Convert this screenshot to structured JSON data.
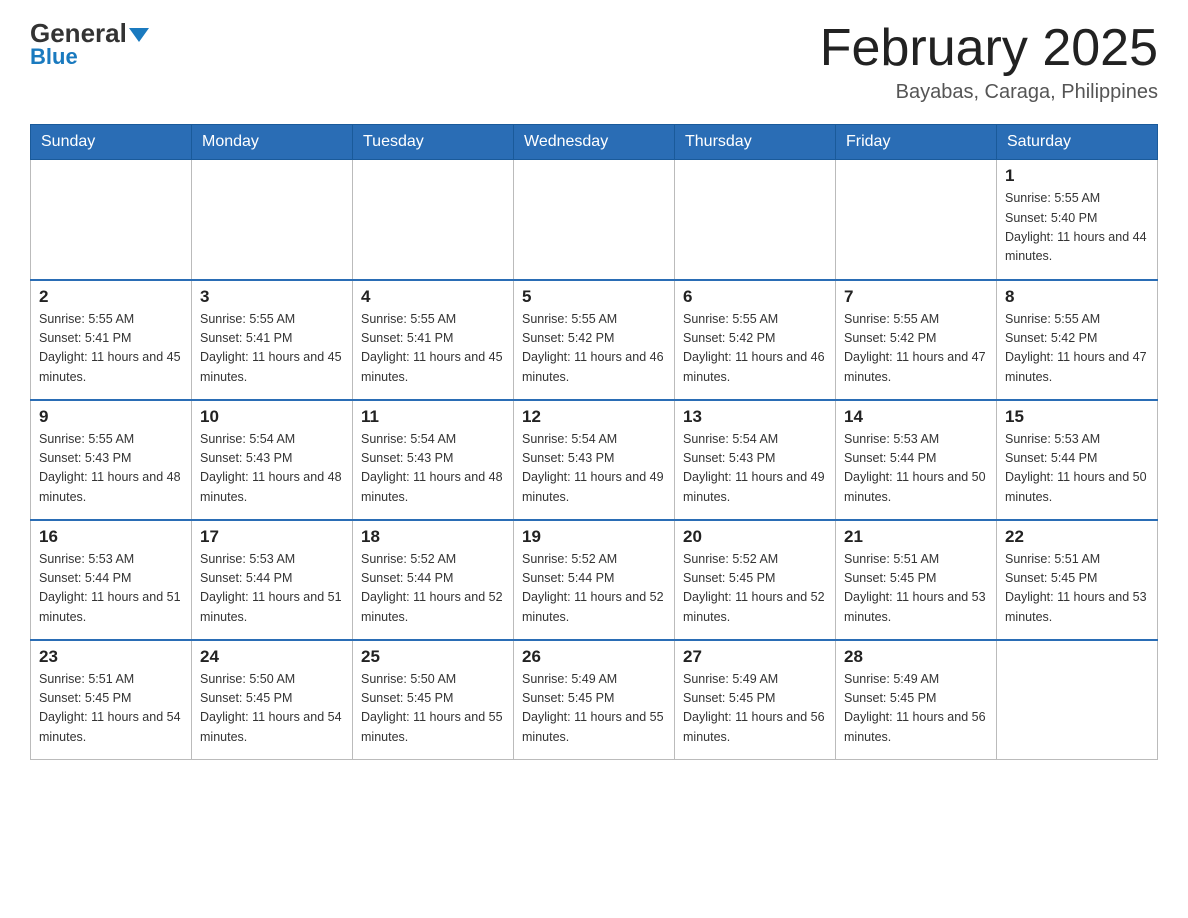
{
  "header": {
    "logo_general": "General",
    "logo_blue": "Blue",
    "month_title": "February 2025",
    "location": "Bayabas, Caraga, Philippines"
  },
  "days_of_week": [
    "Sunday",
    "Monday",
    "Tuesday",
    "Wednesday",
    "Thursday",
    "Friday",
    "Saturday"
  ],
  "weeks": [
    {
      "days": [
        {
          "num": "",
          "sunrise": "",
          "sunset": "",
          "daylight": "",
          "empty": true
        },
        {
          "num": "",
          "sunrise": "",
          "sunset": "",
          "daylight": "",
          "empty": true
        },
        {
          "num": "",
          "sunrise": "",
          "sunset": "",
          "daylight": "",
          "empty": true
        },
        {
          "num": "",
          "sunrise": "",
          "sunset": "",
          "daylight": "",
          "empty": true
        },
        {
          "num": "",
          "sunrise": "",
          "sunset": "",
          "daylight": "",
          "empty": true
        },
        {
          "num": "",
          "sunrise": "",
          "sunset": "",
          "daylight": "",
          "empty": true
        },
        {
          "num": "1",
          "sunrise": "Sunrise: 5:55 AM",
          "sunset": "Sunset: 5:40 PM",
          "daylight": "Daylight: 11 hours and 44 minutes.",
          "empty": false
        }
      ]
    },
    {
      "days": [
        {
          "num": "2",
          "sunrise": "Sunrise: 5:55 AM",
          "sunset": "Sunset: 5:41 PM",
          "daylight": "Daylight: 11 hours and 45 minutes.",
          "empty": false
        },
        {
          "num": "3",
          "sunrise": "Sunrise: 5:55 AM",
          "sunset": "Sunset: 5:41 PM",
          "daylight": "Daylight: 11 hours and 45 minutes.",
          "empty": false
        },
        {
          "num": "4",
          "sunrise": "Sunrise: 5:55 AM",
          "sunset": "Sunset: 5:41 PM",
          "daylight": "Daylight: 11 hours and 45 minutes.",
          "empty": false
        },
        {
          "num": "5",
          "sunrise": "Sunrise: 5:55 AM",
          "sunset": "Sunset: 5:42 PM",
          "daylight": "Daylight: 11 hours and 46 minutes.",
          "empty": false
        },
        {
          "num": "6",
          "sunrise": "Sunrise: 5:55 AM",
          "sunset": "Sunset: 5:42 PM",
          "daylight": "Daylight: 11 hours and 46 minutes.",
          "empty": false
        },
        {
          "num": "7",
          "sunrise": "Sunrise: 5:55 AM",
          "sunset": "Sunset: 5:42 PM",
          "daylight": "Daylight: 11 hours and 47 minutes.",
          "empty": false
        },
        {
          "num": "8",
          "sunrise": "Sunrise: 5:55 AM",
          "sunset": "Sunset: 5:42 PM",
          "daylight": "Daylight: 11 hours and 47 minutes.",
          "empty": false
        }
      ]
    },
    {
      "days": [
        {
          "num": "9",
          "sunrise": "Sunrise: 5:55 AM",
          "sunset": "Sunset: 5:43 PM",
          "daylight": "Daylight: 11 hours and 48 minutes.",
          "empty": false
        },
        {
          "num": "10",
          "sunrise": "Sunrise: 5:54 AM",
          "sunset": "Sunset: 5:43 PM",
          "daylight": "Daylight: 11 hours and 48 minutes.",
          "empty": false
        },
        {
          "num": "11",
          "sunrise": "Sunrise: 5:54 AM",
          "sunset": "Sunset: 5:43 PM",
          "daylight": "Daylight: 11 hours and 48 minutes.",
          "empty": false
        },
        {
          "num": "12",
          "sunrise": "Sunrise: 5:54 AM",
          "sunset": "Sunset: 5:43 PM",
          "daylight": "Daylight: 11 hours and 49 minutes.",
          "empty": false
        },
        {
          "num": "13",
          "sunrise": "Sunrise: 5:54 AM",
          "sunset": "Sunset: 5:43 PM",
          "daylight": "Daylight: 11 hours and 49 minutes.",
          "empty": false
        },
        {
          "num": "14",
          "sunrise": "Sunrise: 5:53 AM",
          "sunset": "Sunset: 5:44 PM",
          "daylight": "Daylight: 11 hours and 50 minutes.",
          "empty": false
        },
        {
          "num": "15",
          "sunrise": "Sunrise: 5:53 AM",
          "sunset": "Sunset: 5:44 PM",
          "daylight": "Daylight: 11 hours and 50 minutes.",
          "empty": false
        }
      ]
    },
    {
      "days": [
        {
          "num": "16",
          "sunrise": "Sunrise: 5:53 AM",
          "sunset": "Sunset: 5:44 PM",
          "daylight": "Daylight: 11 hours and 51 minutes.",
          "empty": false
        },
        {
          "num": "17",
          "sunrise": "Sunrise: 5:53 AM",
          "sunset": "Sunset: 5:44 PM",
          "daylight": "Daylight: 11 hours and 51 minutes.",
          "empty": false
        },
        {
          "num": "18",
          "sunrise": "Sunrise: 5:52 AM",
          "sunset": "Sunset: 5:44 PM",
          "daylight": "Daylight: 11 hours and 52 minutes.",
          "empty": false
        },
        {
          "num": "19",
          "sunrise": "Sunrise: 5:52 AM",
          "sunset": "Sunset: 5:44 PM",
          "daylight": "Daylight: 11 hours and 52 minutes.",
          "empty": false
        },
        {
          "num": "20",
          "sunrise": "Sunrise: 5:52 AM",
          "sunset": "Sunset: 5:45 PM",
          "daylight": "Daylight: 11 hours and 52 minutes.",
          "empty": false
        },
        {
          "num": "21",
          "sunrise": "Sunrise: 5:51 AM",
          "sunset": "Sunset: 5:45 PM",
          "daylight": "Daylight: 11 hours and 53 minutes.",
          "empty": false
        },
        {
          "num": "22",
          "sunrise": "Sunrise: 5:51 AM",
          "sunset": "Sunset: 5:45 PM",
          "daylight": "Daylight: 11 hours and 53 minutes.",
          "empty": false
        }
      ]
    },
    {
      "days": [
        {
          "num": "23",
          "sunrise": "Sunrise: 5:51 AM",
          "sunset": "Sunset: 5:45 PM",
          "daylight": "Daylight: 11 hours and 54 minutes.",
          "empty": false
        },
        {
          "num": "24",
          "sunrise": "Sunrise: 5:50 AM",
          "sunset": "Sunset: 5:45 PM",
          "daylight": "Daylight: 11 hours and 54 minutes.",
          "empty": false
        },
        {
          "num": "25",
          "sunrise": "Sunrise: 5:50 AM",
          "sunset": "Sunset: 5:45 PM",
          "daylight": "Daylight: 11 hours and 55 minutes.",
          "empty": false
        },
        {
          "num": "26",
          "sunrise": "Sunrise: 5:49 AM",
          "sunset": "Sunset: 5:45 PM",
          "daylight": "Daylight: 11 hours and 55 minutes.",
          "empty": false
        },
        {
          "num": "27",
          "sunrise": "Sunrise: 5:49 AM",
          "sunset": "Sunset: 5:45 PM",
          "daylight": "Daylight: 11 hours and 56 minutes.",
          "empty": false
        },
        {
          "num": "28",
          "sunrise": "Sunrise: 5:49 AM",
          "sunset": "Sunset: 5:45 PM",
          "daylight": "Daylight: 11 hours and 56 minutes.",
          "empty": false
        },
        {
          "num": "",
          "sunrise": "",
          "sunset": "",
          "daylight": "",
          "empty": true
        }
      ]
    }
  ]
}
